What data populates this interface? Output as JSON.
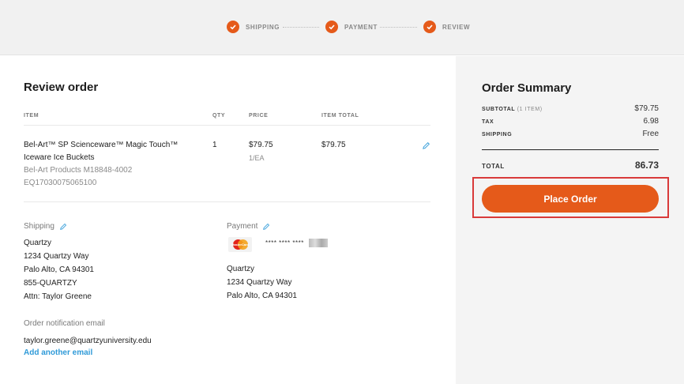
{
  "stepper": {
    "steps": [
      "SHIPPING",
      "PAYMENT",
      "REVIEW"
    ]
  },
  "review": {
    "title": "Review order",
    "headers": {
      "item": "ITEM",
      "qty": "QTY",
      "price": "PRICE",
      "item_total": "ITEM TOTAL"
    },
    "item": {
      "name_line1": "Bel-Art™ SP Scienceware™ Magic Touch™",
      "name_line2": "Iceware Ice Buckets",
      "vendor_sku": "Bel-Art Products M18848-4002",
      "code": "EQ17030075065100",
      "qty": "1",
      "price": "$79.75",
      "unit": "1/EA",
      "item_total": "$79.75"
    },
    "shipping": {
      "title": "Shipping",
      "lines": [
        "Quartzy",
        "1234 Quartzy Way",
        "Palo Alto, CA 94301",
        "855-QUARTZY",
        "Attn: Taylor Greene"
      ]
    },
    "payment": {
      "title": "Payment",
      "card_brand": "mastercard",
      "masked_number": "**** **** ****",
      "lines": [
        "Quartzy",
        "1234 Quartzy Way",
        "Palo Alto, CA 94301"
      ]
    },
    "notification": {
      "title": "Order notification email",
      "email": "taylor.greene@quartzyuniversity.edu",
      "add_link": "Add another email"
    }
  },
  "summary": {
    "title": "Order Summary",
    "subtotal_label": "SUBTOTAL",
    "subtotal_sub": "(1 ITEM)",
    "subtotal_value": "$79.75",
    "tax_label": "TAX",
    "tax_value": "6.98",
    "shipping_label": "SHIPPING",
    "shipping_value": "Free",
    "total_label": "TOTAL",
    "total_value": "86.73",
    "place_order": "Place Order"
  },
  "colors": {
    "accent": "#e55a1a",
    "link": "#2f9ad8",
    "highlight": "#d93a3a"
  }
}
